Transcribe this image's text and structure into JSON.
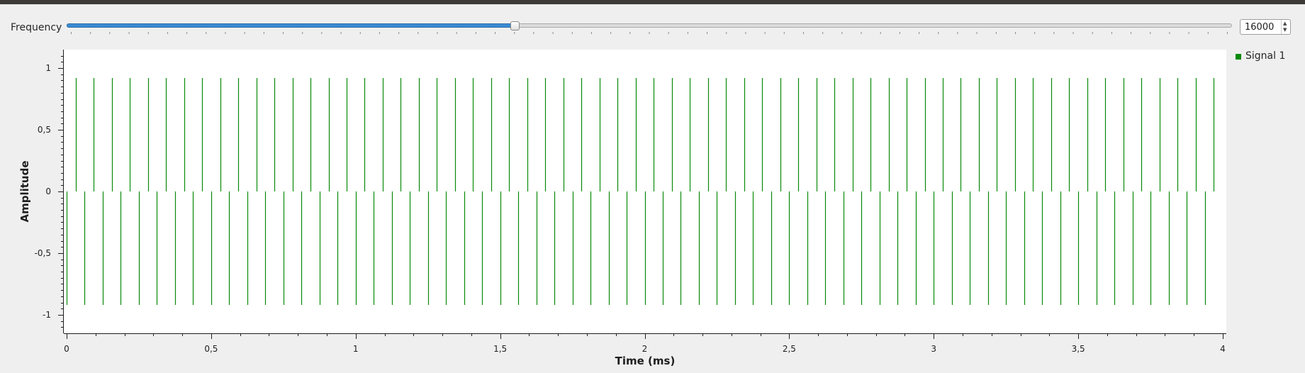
{
  "frequency": {
    "label": "Frequency",
    "slider_fraction": 0.384,
    "spinbox_value": "16000"
  },
  "legend": {
    "items": [
      {
        "name": "Signal 1",
        "color": "#0a8a0a"
      }
    ]
  },
  "chart_data": {
    "type": "line",
    "xlabel": "Time (ms)",
    "ylabel": "Amplitude",
    "xlim": [
      0,
      4
    ],
    "ylim": [
      -1.15,
      1.15
    ],
    "x_ticks": [
      "0",
      "0,5",
      "1",
      "1,5",
      "2",
      "2,5",
      "3",
      "3,5",
      "4"
    ],
    "y_ticks": [
      "1",
      "0,5",
      "0",
      "-0,5",
      "-1"
    ],
    "grid": false,
    "legend_position": "right",
    "series": [
      {
        "name": "Signal 1",
        "color": "#0a8a0a",
        "description": "impulse train alternating between +0.92 and -0.92, period 0.0625 ms, sampled 0 to 4 ms",
        "start_ms": 0,
        "step_ms": 0.03125,
        "count": 128,
        "neg_amplitude": -0.92,
        "pos_amplitude": 0.92
      }
    ]
  }
}
